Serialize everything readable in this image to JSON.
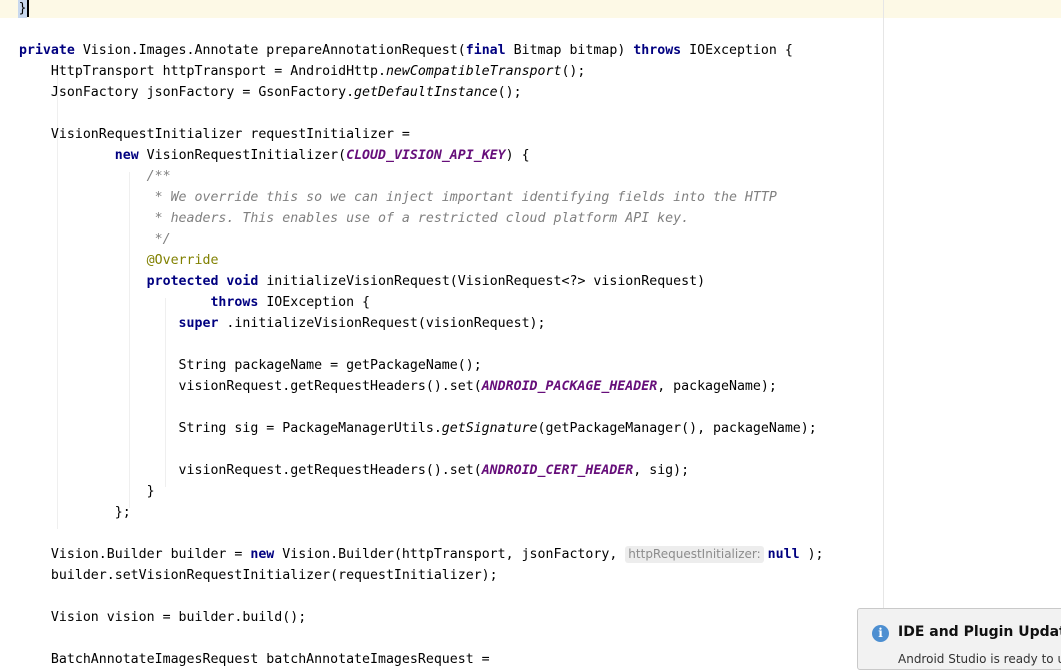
{
  "editor": {
    "caret_line": "}",
    "lines": [
      [
        [
          "kw",
          "private"
        ],
        [
          "",
          "Vision.Images.Annotate prepareAnnotationRequest("
        ],
        [
          "kw",
          "final"
        ],
        [
          "",
          "Bitmap bitmap) "
        ],
        [
          "kw",
          "throws"
        ],
        [
          "",
          "IOException {"
        ]
      ],
      [
        [
          "",
          "    HttpTransport httpTransport = AndroidHttp."
        ],
        [
          "it",
          "newCompatibleTransport"
        ],
        [
          "",
          "();"
        ]
      ],
      [
        [
          "",
          "    JsonFactory jsonFactory = GsonFactory."
        ],
        [
          "it",
          "getDefaultInstance"
        ],
        [
          "",
          "();"
        ]
      ],
      [],
      [
        [
          "",
          "    VisionRequestInitializer requestInitializer ="
        ]
      ],
      [
        [
          "",
          "            "
        ],
        [
          "kw",
          "new"
        ],
        [
          "",
          "VisionRequestInitializer("
        ],
        [
          "const",
          "CLOUD_VISION_API_KEY"
        ],
        [
          "",
          ") {"
        ]
      ],
      [
        [
          "cmt",
          "                /**"
        ]
      ],
      [
        [
          "cmt",
          "                 * We override this so we can inject important identifying fields into the HTTP"
        ]
      ],
      [
        [
          "cmt",
          "                 * headers. This enables use of a restricted cloud platform API key."
        ]
      ],
      [
        [
          "cmt",
          "                 */"
        ]
      ],
      [
        [
          "ann",
          "                @Override"
        ]
      ],
      [
        [
          "",
          "                "
        ],
        [
          "kw",
          "protected"
        ],
        [
          "",
          ""
        ],
        [
          "kw",
          "void"
        ],
        [
          "",
          "initializeVisionRequest(VisionRequest<?> visionRequest)"
        ]
      ],
      [
        [
          "",
          "                        "
        ],
        [
          "kw",
          "throws"
        ],
        [
          "",
          "IOException {"
        ]
      ],
      [
        [
          "",
          "                    "
        ],
        [
          "kw",
          "super"
        ],
        [
          "",
          ".initializeVisionRequest(visionRequest);"
        ]
      ],
      [],
      [
        [
          "",
          "                    String packageName = getPackageName();"
        ]
      ],
      [
        [
          "",
          "                    visionRequest.getRequestHeaders().set("
        ],
        [
          "const",
          "ANDROID_PACKAGE_HEADER"
        ],
        [
          "",
          ", packageName);"
        ]
      ],
      [],
      [
        [
          "",
          "                    String sig = PackageManagerUtils."
        ],
        [
          "it",
          "getSignature"
        ],
        [
          "",
          "(getPackageManager(), packageName);"
        ]
      ],
      [],
      [
        [
          "",
          "                    visionRequest.getRequestHeaders().set("
        ],
        [
          "const",
          "ANDROID_CERT_HEADER"
        ],
        [
          "",
          ", sig);"
        ]
      ],
      [
        [
          "",
          "                }"
        ]
      ],
      [
        [
          "",
          "            };"
        ]
      ],
      [],
      [
        [
          "",
          "    Vision.Builder builder = "
        ],
        [
          "kw",
          "new"
        ],
        [
          "",
          "Vision.Builder(httpTransport, jsonFactory, "
        ],
        [
          "hint",
          "httpRequestInitializer:"
        ],
        [
          "kw",
          "null"
        ],
        [
          "",
          ");"
        ]
      ],
      [
        [
          "",
          "    builder.setVisionRequestInitializer(requestInitializer);"
        ]
      ],
      [],
      [
        [
          "",
          "    Vision vision = builder.build();"
        ]
      ],
      [],
      [
        [
          "",
          "    BatchAnnotateImagesRequest batchAnnotateImagesRequest ="
        ]
      ]
    ]
  },
  "notification": {
    "icon": "info-icon",
    "title": "IDE and Plugin Updates",
    "body": "Android Studio is ready to update."
  }
}
